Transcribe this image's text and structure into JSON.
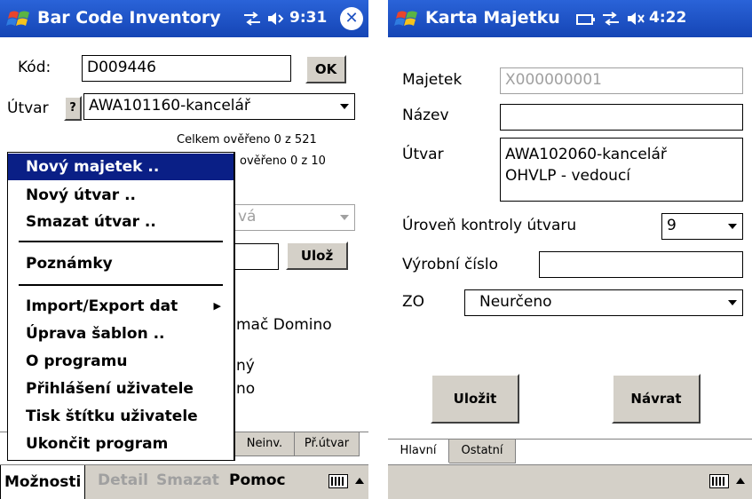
{
  "screen1": {
    "title": "Bar Code Inventory",
    "time": "9:31",
    "kod_label": "Kód:",
    "kod_value": "D009446",
    "ok_label": "OK",
    "utvar_label": "Útvar",
    "help_label": "?",
    "utvar_value": "AWA101160-kancelář",
    "celkem": "Celkem ověřeno 0 z 521",
    "overeno": "ověřeno 0 z 10",
    "combo2_value": "vá",
    "uloz_label": "Ulož",
    "bg_text1": "mač Domino",
    "bg_text2": "ný",
    "bg_text3": "no",
    "menu": {
      "items": [
        "Nový majetek ..",
        "Nový útvar ..",
        "Smazat útvar ..",
        "Poznámky",
        "Import/Export dat",
        "Úprava šablon ..",
        "O programu",
        "Přihlášení uživatele",
        "Tisk štítku uživatele",
        "Ukončit program"
      ],
      "submenu_arrow": "▶"
    },
    "tabs": [
      "Neinv.",
      "Př.útvar"
    ],
    "cmd": {
      "moznosti": "Možnosti",
      "detail": "Detail",
      "smazat": "Smazat",
      "pomoc": "Pomoc"
    }
  },
  "screen2": {
    "title": "Karta Majetku",
    "time": "4:22",
    "majetek_label": "Majetek",
    "majetek_value": "X000000001",
    "nazev_label": "Název",
    "nazev_value": "",
    "utvar_label": "Útvar",
    "utvar_line1": "AWA102060-kancelář",
    "utvar_line2": "OHVLP - vedoucí",
    "uroven_label": "Úroveň kontroly útvaru",
    "uroven_value": "9",
    "vyrobni_label": "Výrobní číslo",
    "vyrobni_value": "",
    "zo_label": "ZO",
    "zo_value": "Neurčeno",
    "ulozit_label": "Uložit",
    "navrat_label": "Návrat",
    "tabs": [
      "Hlavní",
      "Ostatní"
    ]
  },
  "colors": {
    "titlebar": "#1f52c2",
    "menu_highlight": "#0a1f86",
    "button_face": "#d4d0c8"
  }
}
